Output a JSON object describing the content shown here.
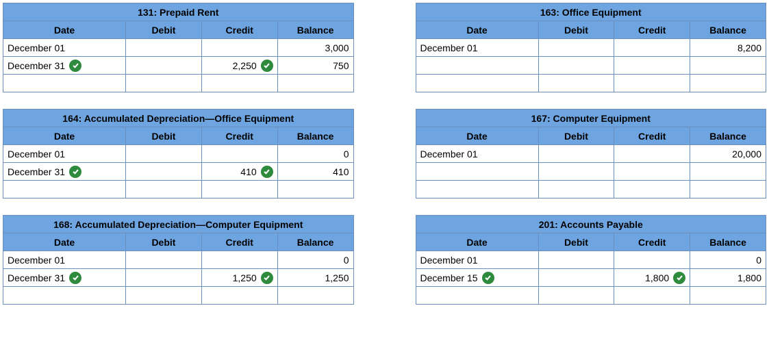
{
  "columns": {
    "date": "Date",
    "debit": "Debit",
    "credit": "Credit",
    "balance": "Balance"
  },
  "accounts": [
    {
      "title": "131: Prepaid Rent",
      "rows": [
        {
          "date": "December 01",
          "date_ok": false,
          "debit": "",
          "debit_ok": false,
          "credit": "",
          "credit_ok": false,
          "balance": "3,000"
        },
        {
          "date": "December 31",
          "date_ok": true,
          "debit": "",
          "debit_ok": false,
          "credit": "2,250",
          "credit_ok": true,
          "balance": "750"
        },
        {
          "date": "",
          "date_ok": false,
          "debit": "",
          "debit_ok": false,
          "credit": "",
          "credit_ok": false,
          "balance": ""
        }
      ]
    },
    {
      "title": "163: Office Equipment",
      "rows": [
        {
          "date": "December 01",
          "date_ok": false,
          "debit": "",
          "debit_ok": false,
          "credit": "",
          "credit_ok": false,
          "balance": "8,200"
        },
        {
          "date": "",
          "date_ok": false,
          "debit": "",
          "debit_ok": false,
          "credit": "",
          "credit_ok": false,
          "balance": ""
        },
        {
          "date": "",
          "date_ok": false,
          "debit": "",
          "debit_ok": false,
          "credit": "",
          "credit_ok": false,
          "balance": ""
        }
      ]
    },
    {
      "title": "164: Accumulated Depreciation—Office Equipment",
      "rows": [
        {
          "date": "December 01",
          "date_ok": false,
          "debit": "",
          "debit_ok": false,
          "credit": "",
          "credit_ok": false,
          "balance": "0"
        },
        {
          "date": "December 31",
          "date_ok": true,
          "debit": "",
          "debit_ok": false,
          "credit": "410",
          "credit_ok": true,
          "balance": "410"
        },
        {
          "date": "",
          "date_ok": false,
          "debit": "",
          "debit_ok": false,
          "credit": "",
          "credit_ok": false,
          "balance": ""
        }
      ]
    },
    {
      "title": "167: Computer Equipment",
      "rows": [
        {
          "date": "December 01",
          "date_ok": false,
          "debit": "",
          "debit_ok": false,
          "credit": "",
          "credit_ok": false,
          "balance": "20,000"
        },
        {
          "date": "",
          "date_ok": false,
          "debit": "",
          "debit_ok": false,
          "credit": "",
          "credit_ok": false,
          "balance": ""
        },
        {
          "date": "",
          "date_ok": false,
          "debit": "",
          "debit_ok": false,
          "credit": "",
          "credit_ok": false,
          "balance": ""
        }
      ]
    },
    {
      "title": "168: Accumulated Depreciation—Computer Equipment",
      "rows": [
        {
          "date": "December 01",
          "date_ok": false,
          "debit": "",
          "debit_ok": false,
          "credit": "",
          "credit_ok": false,
          "balance": "0"
        },
        {
          "date": "December 31",
          "date_ok": true,
          "debit": "",
          "debit_ok": false,
          "credit": "1,250",
          "credit_ok": true,
          "balance": "1,250"
        },
        {
          "date": "",
          "date_ok": false,
          "debit": "",
          "debit_ok": false,
          "credit": "",
          "credit_ok": false,
          "balance": ""
        }
      ]
    },
    {
      "title": "201: Accounts Payable",
      "rows": [
        {
          "date": "December 01",
          "date_ok": false,
          "debit": "",
          "debit_ok": false,
          "credit": "",
          "credit_ok": false,
          "balance": "0"
        },
        {
          "date": "December 15",
          "date_ok": true,
          "debit": "",
          "debit_ok": false,
          "credit": "1,800",
          "credit_ok": true,
          "balance": "1,800"
        },
        {
          "date": "",
          "date_ok": false,
          "debit": "",
          "debit_ok": false,
          "credit": "",
          "credit_ok": false,
          "balance": ""
        }
      ]
    }
  ]
}
